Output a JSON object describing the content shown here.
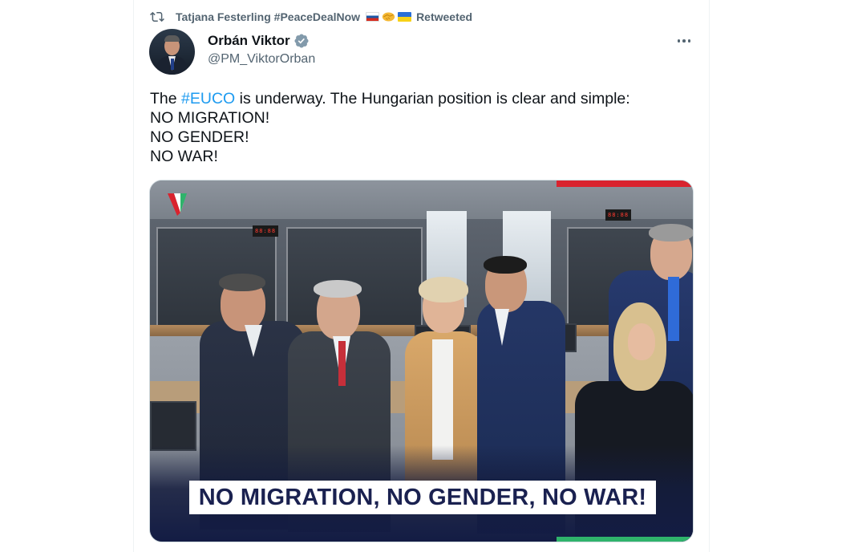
{
  "retweet": {
    "icon": "retweet-icon",
    "retweeter_name": "Tatjana Festerling #PeaceDealNow",
    "emoji": [
      "russia-flag",
      "handshake",
      "ukraine-flag"
    ],
    "label": "Retweeted"
  },
  "tweet": {
    "author_name": "Orbán Viktor",
    "verified": true,
    "author_handle": "@PM_ViktorOrban",
    "text_prefix": "The ",
    "hashtag": "#EUCO",
    "text_suffix": " is underway. The Hungarian position is clear and simple:",
    "lines": [
      "NO MIGRATION!",
      "NO GENDER!",
      "NO WAR!"
    ],
    "more_icon": "more-icon"
  },
  "media": {
    "banner_text": "NO MIGRATION, NO GENDER, NO WAR!",
    "signs": [
      "88:88",
      "88:88"
    ],
    "colors": {
      "banner_text": "#1a2150",
      "bottom_gradient": "#131c44",
      "top_bar": "#d9232e",
      "bottom_bar": "#2fb36b"
    }
  },
  "colors": {
    "link": "#1d9bf0",
    "secondary_text": "#536471",
    "primary_text": "#0f1419",
    "verified": "#829aab"
  }
}
